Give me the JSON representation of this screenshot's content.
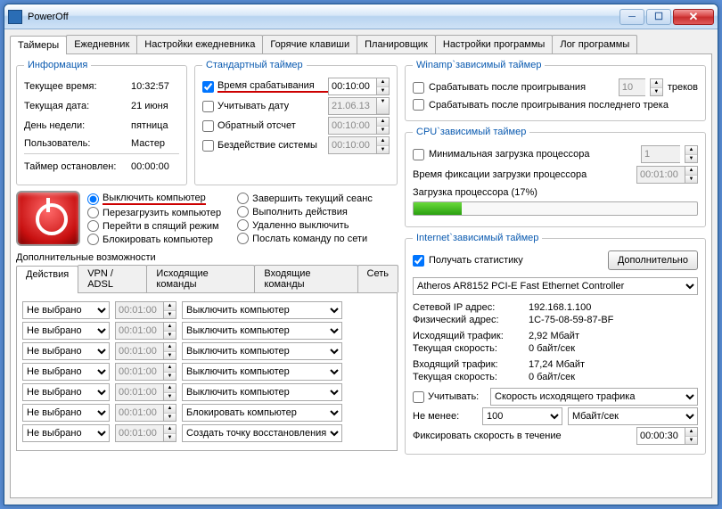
{
  "title": "PowerOff",
  "tabs": [
    "Таймеры",
    "Ежедневник",
    "Настройки ежедневника",
    "Горячие клавиши",
    "Планировщик",
    "Настройки программы",
    "Лог программы"
  ],
  "info": {
    "legend": "Информация",
    "time_lbl": "Текущее время:",
    "time": "10:32:57",
    "date_lbl": "Текущая дата:",
    "date": "21 июня",
    "dow_lbl": "День недели:",
    "dow": "пятница",
    "user_lbl": "Пользователь:",
    "user": "Мастер",
    "stopped_lbl": "Таймер остановлен:",
    "stopped": "00:00:00"
  },
  "std": {
    "legend": "Стандартный таймер",
    "trigger_lbl": "Время срабатывания",
    "trigger_val": "00:10:00",
    "date_lbl": "Учитывать дату",
    "date_val": "21.06.13",
    "countdown_lbl": "Обратный отсчет",
    "countdown_val": "00:10:00",
    "idle_lbl": "Бездействие системы",
    "idle_val": "00:10:00"
  },
  "actions": {
    "shutdown": "Выключить компьютер",
    "restart": "Перезагрузить компьютер",
    "sleep": "Перейти в спящий режим",
    "lock": "Блокировать компьютер",
    "logoff": "Завершить текущий сеанс",
    "exec": "Выполнить действия",
    "remote": "Удаленно выключить",
    "netcmd": "Послать команду по сети"
  },
  "extra_lbl": "Дополнительные возможности",
  "subtabs": [
    "Действия",
    "VPN / ADSL",
    "Исходящие команды",
    "Входящие команды",
    "Сеть"
  ],
  "action_rows": [
    {
      "sel": "Не выбрано",
      "time": "00:01:00",
      "act": "Выключить компьютер"
    },
    {
      "sel": "Не выбрано",
      "time": "00:01:00",
      "act": "Выключить компьютер"
    },
    {
      "sel": "Не выбрано",
      "time": "00:01:00",
      "act": "Выключить компьютер"
    },
    {
      "sel": "Не выбрано",
      "time": "00:01:00",
      "act": "Выключить компьютер"
    },
    {
      "sel": "Не выбрано",
      "time": "00:01:00",
      "act": "Выключить компьютер"
    },
    {
      "sel": "Не выбрано",
      "time": "00:01:00",
      "act": "Блокировать компьютер"
    },
    {
      "sel": "Не выбрано",
      "time": "00:01:00",
      "act": "Создать точку восстановления"
    }
  ],
  "winamp": {
    "legend": "Winamp`зависимый таймер",
    "after_play": "Срабатывать после проигрывания",
    "tracks_val": "10",
    "tracks_lbl": "треков",
    "after_last": "Срабатывать после проигрывания последнего трека"
  },
  "cpu": {
    "legend": "CPU`зависимый таймер",
    "min_load": "Минимальная загрузка процессора",
    "min_val": "1",
    "fix_time_lbl": "Время фиксации загрузки процессора",
    "fix_time": "00:01:00",
    "load_lbl": "Загрузка процессора (17%)",
    "load_pct": 17
  },
  "net": {
    "legend": "Internet`зависимый таймер",
    "stats": "Получать статистику",
    "more": "Дополнительно",
    "adapter": "Atheros AR8152 PCI-E Fast Ethernet Controller",
    "ip_lbl": "Сетевой IP адрес:",
    "ip": "192.168.1.100",
    "mac_lbl": "Физический адрес:",
    "mac": "1C-75-08-59-87-BF",
    "out_lbl": "Исходящий трафик:",
    "out": "2,92 Мбайт",
    "speed_lbl": "Текущая скорость:",
    "speed": "0 байт/сек",
    "in_lbl": "Входящий трафик:",
    "in": "17,24 Мбайт",
    "speed2": "0 байт/сек",
    "consider": "Учитывать:",
    "consider_val": "Скорость исходящего трафика",
    "min_lbl": "Не менее:",
    "min_val": "100",
    "min_unit": "Мбайт/сек",
    "fix_lbl": "Фиксировать скорость в течение",
    "fix_time": "00:00:30"
  }
}
